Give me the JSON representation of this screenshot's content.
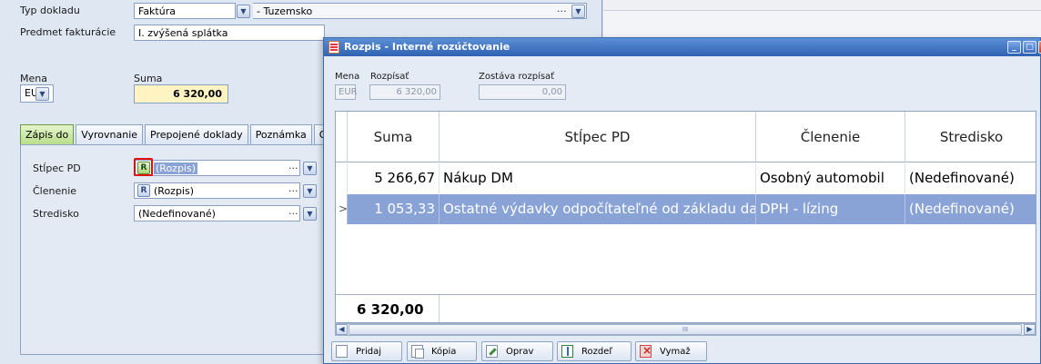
{
  "form": {
    "typ_dokladu_label": "Typ dokladu",
    "typ_dokladu_value": "Faktúra",
    "typ_dokladu_second": "- Tuzemsko",
    "predmet_label": "Predmet fakturácie",
    "predmet_value": "I. zvýšená splátka",
    "mena_label": "Mena",
    "mena_value": "EUR",
    "suma_label": "Suma",
    "suma_value": "6 320,00",
    "dots": "···",
    "tabs": [
      "Zápis do",
      "Vyrovnanie",
      "Prepojené doklady",
      "Poznámka",
      "Osta"
    ],
    "stlpec_label": "Stĺpec PD",
    "stlpec_value": "(Rozpis)",
    "clenenie_label": "Členenie",
    "clenenie_value": "(Rozpis)",
    "stredisko_label": "Stredisko",
    "stredisko_value": "(Nedefinované)",
    "badge": "R"
  },
  "dialog": {
    "title": "Rozpis - Interné rozúčtovanie",
    "mena_label": "Mena",
    "mena_value": "EUR",
    "rozpisat_label": "Rozpísať",
    "rozpisat_value": "6 320,00",
    "zostava_label": "Zostáva rozpísať",
    "zostava_value": "0,00",
    "columns": [
      "Suma",
      "Stĺpec PD",
      "Členenie",
      "Stredisko"
    ],
    "rows": [
      {
        "indicator": "",
        "suma": "5 266,67",
        "stlpec": "Nákup DM",
        "clenenie": "Osobný automobil",
        "stredisko": "(Nedefinované)"
      },
      {
        "indicator": ">",
        "suma": "1 053,33",
        "stlpec": "Ostatné výdavky odpočítateľné od základu dane",
        "clenenie": "DPH - lízing",
        "stredisko": "(Nedefinované)"
      }
    ],
    "total": "6 320,00",
    "scroll_grip": "III",
    "buttons": {
      "pridaj": "Pridaj",
      "kopia": "Kópia",
      "oprav": "Oprav",
      "rozdel": "Rozdeľ",
      "vymaz": "Vymaž"
    }
  }
}
